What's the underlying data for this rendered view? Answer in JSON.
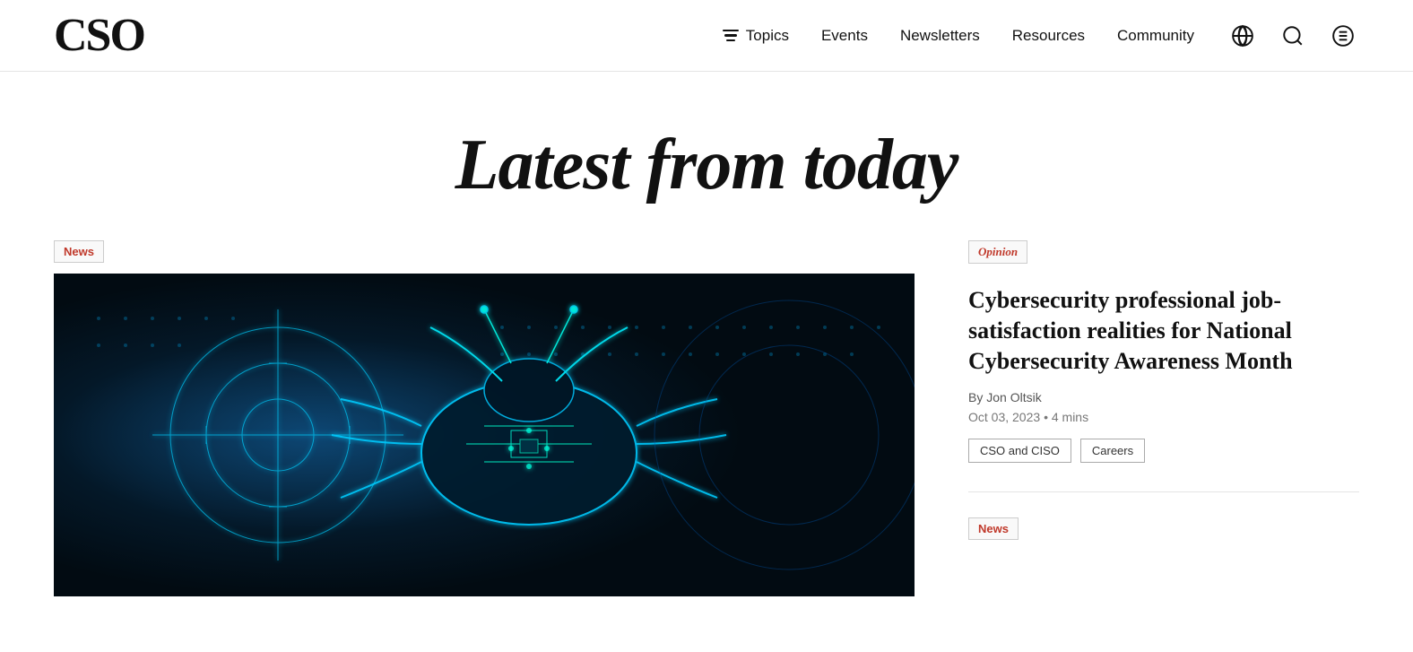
{
  "header": {
    "logo": "CSO",
    "nav": {
      "topics_label": "Topics",
      "events_label": "Events",
      "newsletters_label": "Newsletters",
      "resources_label": "Resources",
      "community_label": "Community"
    }
  },
  "hero": {
    "title": "Latest from today"
  },
  "featured": {
    "badge": "News"
  },
  "sidebar": {
    "article1": {
      "badge": "Opinion",
      "title": "Cybersecurity professional job-satisfaction realities for National Cybersecurity Awareness Month",
      "byline": "By Jon Oltsik",
      "date": "Oct 03, 2023",
      "read_time": "4 mins",
      "tags": [
        "CSO and CISO",
        "Careers"
      ]
    },
    "article2": {
      "badge": "News"
    }
  }
}
